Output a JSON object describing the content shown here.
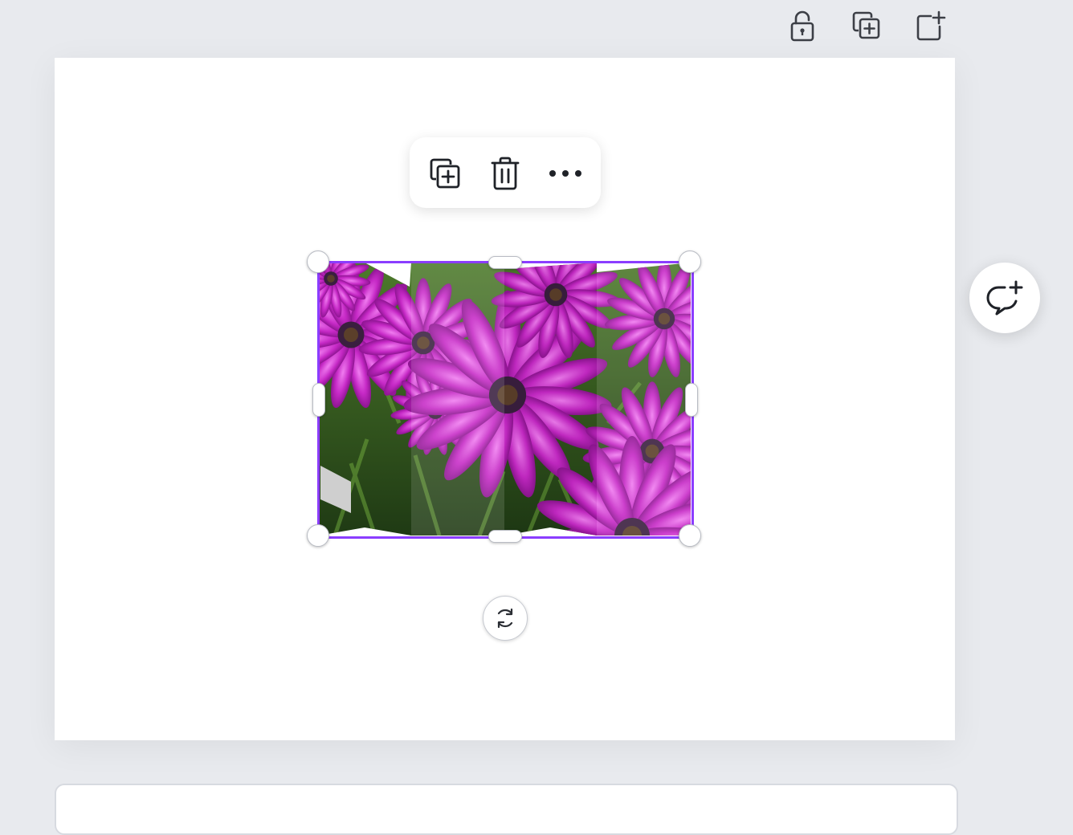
{
  "page_toolbar": {
    "icons": [
      "lock-open-icon",
      "duplicate-page-icon",
      "add-page-icon"
    ]
  },
  "context_toolbar": {
    "icons": [
      "duplicate-icon",
      "trash-icon",
      "more-options-icon"
    ]
  },
  "selected_element": {
    "type": "image",
    "description_icon": "purple-daisies-folded-map-image",
    "selection_color": "#8b3dff"
  },
  "rotate_handle": {
    "icon": "rotate-icon"
  },
  "comment_button": {
    "icon": "add-comment-icon"
  },
  "colors": {
    "background": "#e8eaee",
    "page": "#ffffff",
    "accent": "#8b3dff",
    "icon": "#3c3f46"
  }
}
